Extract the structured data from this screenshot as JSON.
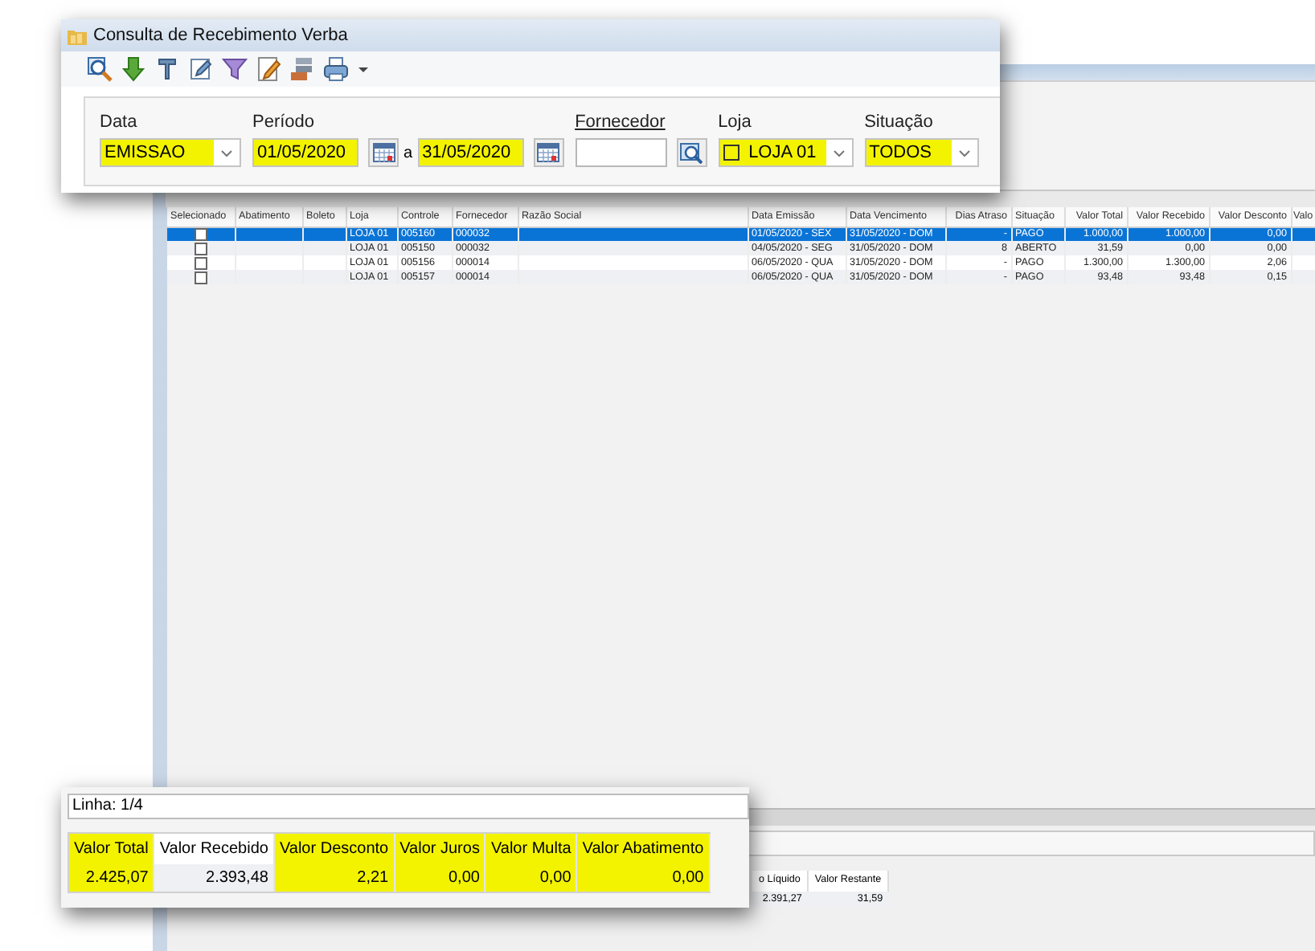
{
  "window": {
    "title": "Consulta de Recebimento Verba"
  },
  "filters": [
    {
      "kind": "combo",
      "label": "Data",
      "value": "EMISSAO",
      "highlighted": true
    },
    {
      "kind": "date_range",
      "label": "Período",
      "from": "01/05/2020",
      "separator": "a",
      "to": "31/05/2020",
      "highlighted": true
    },
    {
      "kind": "lookup",
      "label": "Fornecedor",
      "highlighted": false
    },
    {
      "kind": "check_combo",
      "label": "Loja",
      "value": "LOJA 01",
      "checked": false,
      "highlighted": true
    },
    {
      "kind": "combo",
      "label": "Situação",
      "value": "TODOS",
      "highlighted": true
    }
  ],
  "table": {
    "columns": [
      {
        "label": "Selecionado",
        "kind": "check"
      },
      {
        "label": "Abatimento",
        "kind": "blank"
      },
      {
        "label": "Boleto",
        "kind": "blank"
      },
      {
        "label": "Loja",
        "kind": "text"
      },
      {
        "label": "Controle",
        "kind": "text"
      },
      {
        "label": "Fornecedor",
        "kind": "text"
      },
      {
        "label": "Razão Social",
        "kind": "blank"
      },
      {
        "label": "Data Emissão",
        "kind": "text"
      },
      {
        "label": "Data Vencimento",
        "kind": "text"
      },
      {
        "label": "Dias Atraso",
        "kind": "number"
      },
      {
        "label": "Situação",
        "kind": "text"
      },
      {
        "label": "Valor Total",
        "kind": "number"
      },
      {
        "label": "Valor Recebido",
        "kind": "number"
      },
      {
        "label": "Valor Desconto",
        "kind": "number"
      },
      {
        "label": "Valo",
        "kind": "blank"
      }
    ],
    "rows": [
      {
        "selected": true,
        "checked": false,
        "cells": [
          "",
          "",
          "",
          "LOJA 01",
          "005160",
          "000032",
          "",
          "01/05/2020 - SEX",
          "31/05/2020 - DOM",
          "-",
          "PAGO",
          "1.000,00",
          "1.000,00",
          "0,00"
        ]
      },
      {
        "selected": false,
        "checked": false,
        "cells": [
          "",
          "",
          "",
          "LOJA 01",
          "005150",
          "000032",
          "",
          "04/05/2020 - SEG",
          "31/05/2020 - DOM",
          "8",
          "ABERTO",
          "31,59",
          "0,00",
          "0,00"
        ]
      },
      {
        "selected": false,
        "checked": false,
        "cells": [
          "",
          "",
          "",
          "LOJA 01",
          "005156",
          "000014",
          "",
          "06/05/2020 - QUA",
          "31/05/2020 - DOM",
          "-",
          "PAGO",
          "1.300,00",
          "1.300,00",
          "2,06"
        ]
      },
      {
        "selected": false,
        "checked": false,
        "cells": [
          "",
          "",
          "",
          "LOJA 01",
          "005157",
          "000014",
          "",
          "06/05/2020 - QUA",
          "31/05/2020 - DOM",
          "-",
          "PAGO",
          "93,48",
          "93,48",
          "0,15"
        ]
      }
    ]
  },
  "status_bar": {
    "line": "Linha: 1/4"
  },
  "totals": [
    {
      "label": "Valor Total",
      "value": "2.425,07",
      "highlighted": true
    },
    {
      "label": "Valor Recebido",
      "value": "2.393,48",
      "highlighted": false
    },
    {
      "label": "Valor Desconto",
      "value": "2,21",
      "highlighted": true
    },
    {
      "label": "Valor Juros",
      "value": "0,00",
      "highlighted": true
    },
    {
      "label": "Valor Multa",
      "value": "0,00",
      "highlighted": true
    },
    {
      "label": "Valor Abatimento",
      "value": "0,00",
      "highlighted": true
    }
  ],
  "background_totals": [
    {
      "label": "o Líquido",
      "value": "2.391,27"
    },
    {
      "label": "Valor Restante",
      "value": "31,59"
    }
  ]
}
